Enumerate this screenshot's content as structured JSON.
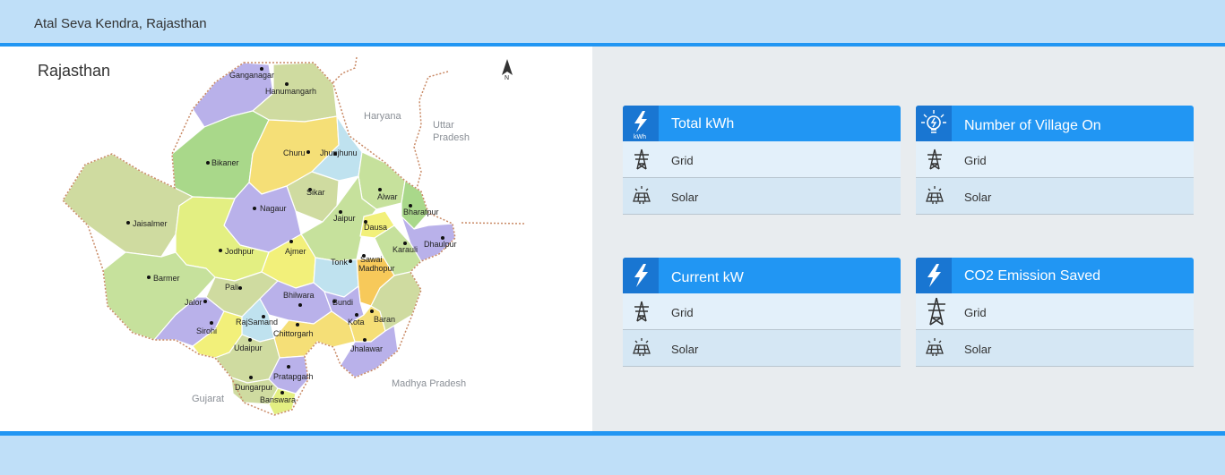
{
  "header": {
    "title": "Atal Seva Kendra, Rajasthan"
  },
  "map": {
    "title": "Rajasthan",
    "compass": "N",
    "neighbors": [
      "Haryana",
      "Uttar Pradesh",
      "Gujarat",
      "Madhya Pradesh"
    ],
    "districts": [
      "Ganganagar",
      "Hanumangarh",
      "Bikaner",
      "Churu",
      "Jhunjhunu",
      "Sikar",
      "Alwar",
      "Bharatpur",
      "Jaisalmer",
      "Nagaur",
      "Jaipur",
      "Dausa",
      "Dhaulpur",
      "Karauli",
      "Jodhpur",
      "Ajmer",
      "Tonk",
      "Sawai Madhopur",
      "Barmer",
      "Pali",
      "Bhilwara",
      "Bundi",
      "Jalor",
      "RajSamand",
      "Kota",
      "Baran",
      "Sirohi",
      "Chittorgarh",
      "Udaipur",
      "Jhalawar",
      "Pratapgarh",
      "Dungarpur",
      "Banswara"
    ]
  },
  "cards": [
    {
      "title": "Total kWh",
      "icon": "kwh-bolt-icon",
      "icon_text": "kWh",
      "rows": [
        {
          "label": "Grid",
          "icon": "power-tower-icon"
        },
        {
          "label": "Solar",
          "icon": "solar-panel-icon"
        }
      ]
    },
    {
      "title": "Number of Village On",
      "icon": "bulb-icon",
      "rows": [
        {
          "label": "Grid",
          "icon": "power-tower-icon"
        },
        {
          "label": "Solar",
          "icon": "solar-panel-icon"
        }
      ]
    },
    {
      "title": "Current kW",
      "icon": "bolt-icon",
      "rows": [
        {
          "label": "Grid",
          "icon": "power-tower-icon"
        },
        {
          "label": "Solar",
          "icon": "solar-panel-icon"
        }
      ]
    },
    {
      "title": "CO2 Emission Saved",
      "icon": "bolt-icon",
      "rows": [
        {
          "label": "Grid",
          "icon": "power-tower-icon"
        },
        {
          "label": "Solar",
          "icon": "solar-panel-icon"
        }
      ]
    }
  ],
  "colors": {
    "accent": "#2196f3",
    "accent_dark": "#1976d2",
    "header_bg": "#bfdff8",
    "panel_bg": "#e8ecef"
  }
}
